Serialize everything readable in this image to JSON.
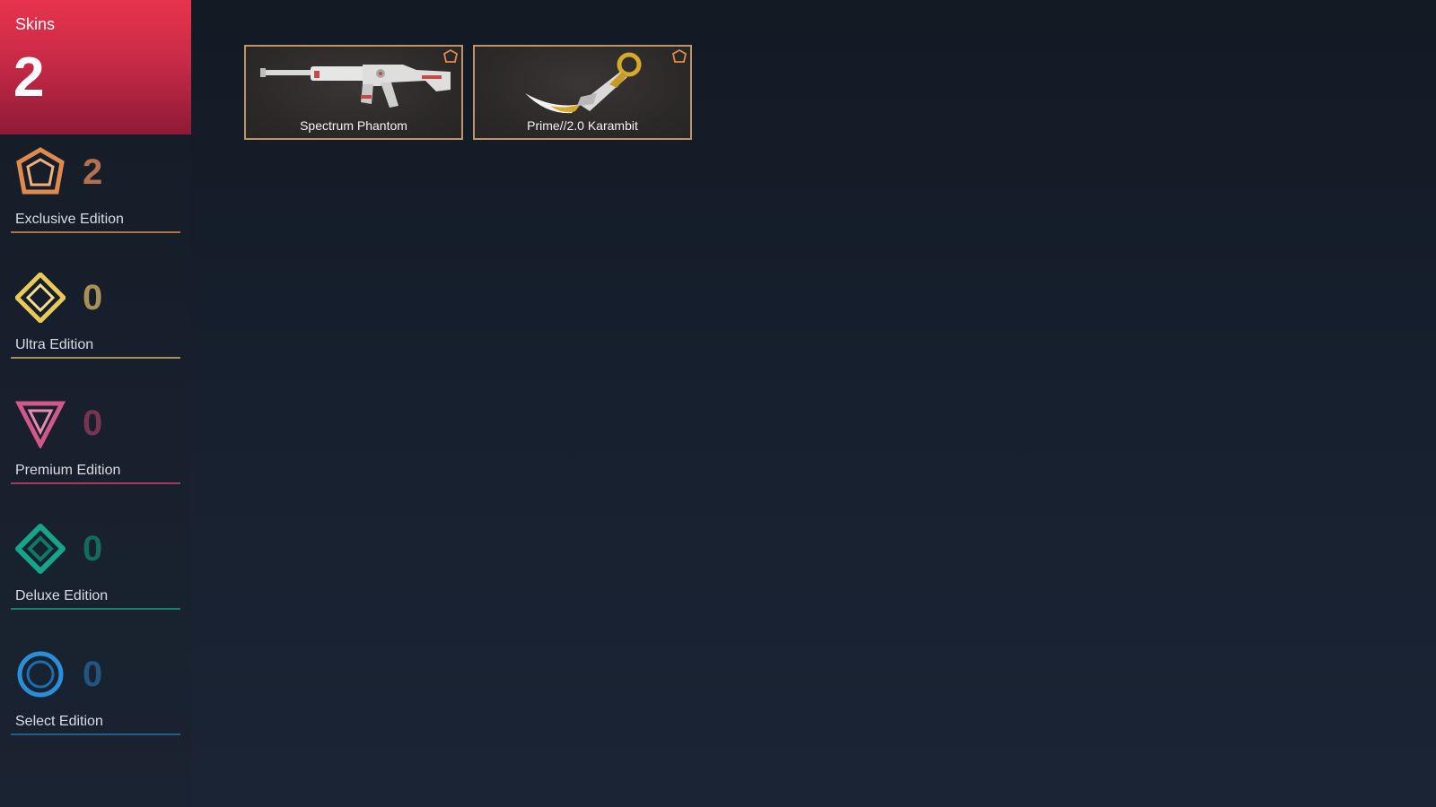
{
  "header": {
    "label": "Skins",
    "count": "2"
  },
  "tiers": [
    {
      "name": "Exclusive Edition",
      "count": "2",
      "color": "#e08a4e",
      "icon": "exclusive-edition-icon"
    },
    {
      "name": "Ultra Edition",
      "count": "0",
      "color": "#e8c95a",
      "icon": "ultra-edition-icon"
    },
    {
      "name": "Premium Edition",
      "count": "0",
      "color": "#d2588c",
      "icon": "premium-edition-icon"
    },
    {
      "name": "Deluxe Edition",
      "count": "0",
      "color": "#17a58a",
      "icon": "deluxe-edition-icon"
    },
    {
      "name": "Select Edition",
      "count": "0",
      "color": "#2b8ed8",
      "icon": "select-edition-icon"
    }
  ],
  "skins": [
    {
      "name": "Spectrum Phantom",
      "tier": "Exclusive Edition"
    },
    {
      "name": "Prime//2.0 Karambit",
      "tier": "Exclusive Edition"
    }
  ],
  "colors": {
    "header_accent": "#e8334e",
    "card_border": "#bf946a",
    "background": "#141c27"
  }
}
